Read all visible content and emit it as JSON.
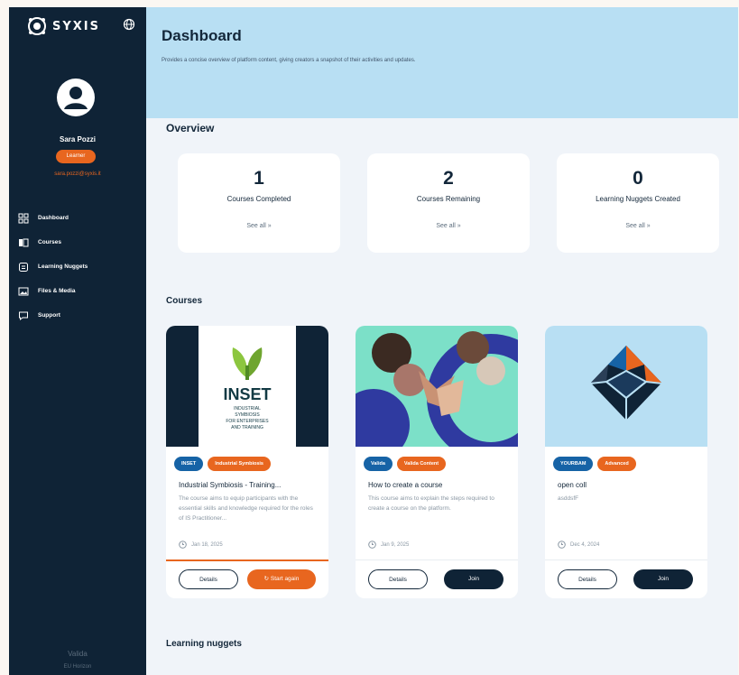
{
  "sidebar": {
    "logo_text": "SYXIS",
    "user_name": "Sara Pozzi",
    "role": "Learner",
    "email": "sara.pozzi@syxis.it",
    "items": [
      {
        "label": "Dashboard",
        "icon": "grid-icon"
      },
      {
        "label": "Courses",
        "icon": "book-icon"
      },
      {
        "label": "Learning Nuggets",
        "icon": "nugget-icon"
      },
      {
        "label": "Files & Media",
        "icon": "image-icon"
      },
      {
        "label": "Support",
        "icon": "chat-icon"
      }
    ],
    "footer": "Valida",
    "footer_sub": "EU Horizon"
  },
  "header": {
    "title": "Dashboard",
    "subtitle": "Provides a concise overview of platform content, giving creators a snapshot of their activities and updates."
  },
  "overview": {
    "title": "Overview",
    "cards": [
      {
        "value": "1",
        "label": "Courses Completed",
        "link": "See all »"
      },
      {
        "value": "2",
        "label": "Courses Remaining",
        "link": "See all »"
      },
      {
        "value": "0",
        "label": "Learning Nuggets Created",
        "link": "See all »"
      }
    ]
  },
  "courses": {
    "title": "Courses",
    "items": [
      {
        "tags": [
          "INSET",
          "Industrial Symbiosis"
        ],
        "title": "Industrial Symbiosis - Training...",
        "desc": "The course aims to equip participants with the essential skills and knowledge required for the roles of IS Practitioner...",
        "date": "Jan 18, 2025",
        "btn1": "Details",
        "btn2": "Start again",
        "image_brand": "INSET",
        "image_sub1": "INDUSTRIAL",
        "image_sub2": "SYMBIOSIS",
        "image_sub3": "FOR ENTERPRISES",
        "image_sub4": "AND TRAINING"
      },
      {
        "tags": [
          "Valida",
          "Valida Content"
        ],
        "title": "How to create a course",
        "desc": "This course aims to explain the steps required to create a course on the platform.",
        "date": "Jan 9, 2025",
        "btn1": "Details",
        "btn2": "Join"
      },
      {
        "tags": [
          "YOURBAM",
          "Advanced"
        ],
        "title": "open coll",
        "desc": "asddsfF",
        "date": "Dec 4, 2024",
        "btn1": "Details",
        "btn2": "Join"
      }
    ]
  },
  "nuggets": {
    "title": "Learning nuggets"
  },
  "colors": {
    "sidebar": "#0f2336",
    "header": "#b8dff3",
    "accent": "#e8661f",
    "tag_blue": "#1663a6"
  }
}
